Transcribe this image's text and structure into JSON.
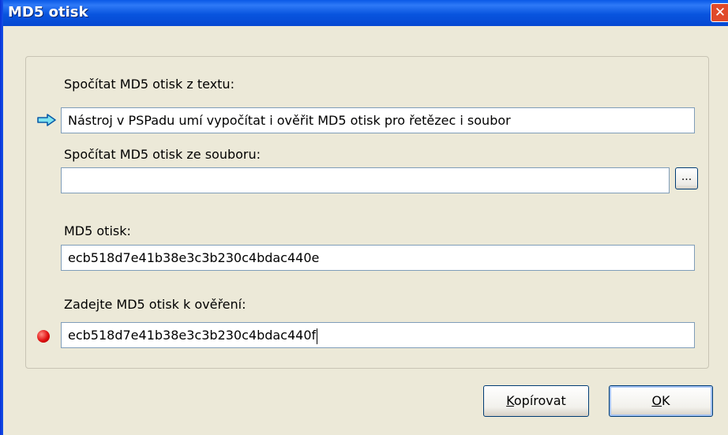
{
  "window": {
    "title": "MD5 otisk",
    "close_glyph": "✕"
  },
  "from_text": {
    "label": "Spočítat MD5 otisk z textu:",
    "value": "Nástroj v PSPadu umí vypočítat i ověřit MD5 otisk pro řetězec i soubor",
    "indicator_icon": "arrow-right-icon"
  },
  "from_file": {
    "label": "Spočítat MD5 otisk ze souboru:",
    "value": "",
    "browse_label": "..."
  },
  "hash": {
    "label": "MD5 otisk:",
    "value": "ecb518d7e41b38e3c3b230c4bdac440e"
  },
  "verify": {
    "label": "Zadejte MD5 otisk k ověření:",
    "value": "ecb518d7e41b38e3c3b230c4bdac440f",
    "status_icon": "red-dot-icon",
    "status_color": "#E01010"
  },
  "buttons": {
    "copy_first": "K",
    "copy_rest": "opírovat",
    "ok_first": "O",
    "ok_rest": "K"
  }
}
